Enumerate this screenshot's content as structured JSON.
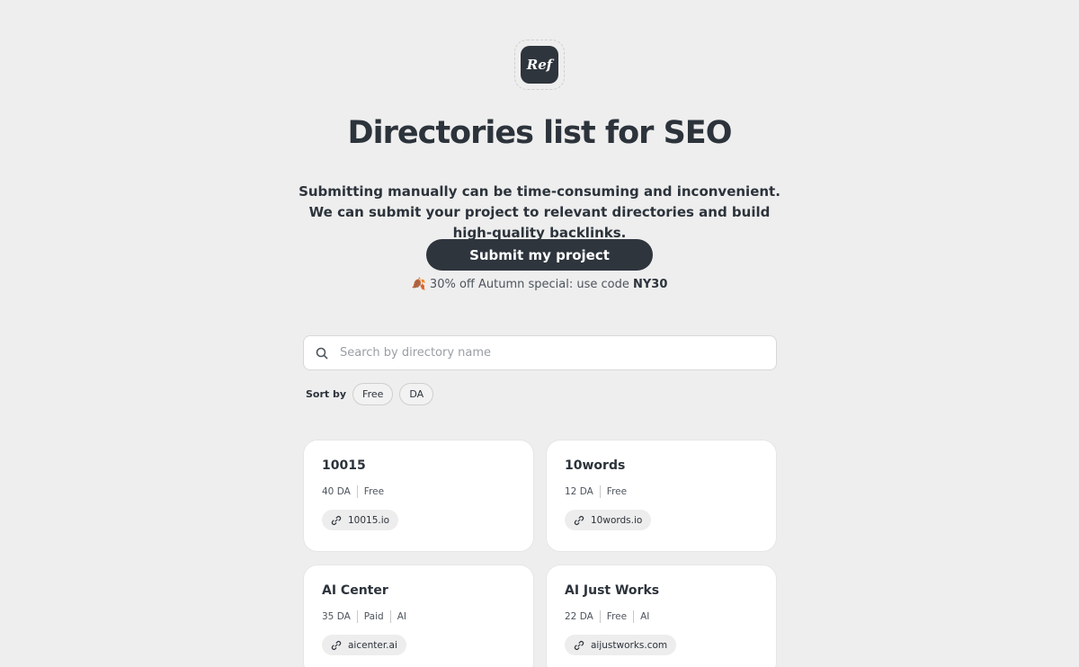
{
  "logo": {
    "text": "Ref"
  },
  "hero": {
    "title": "Directories list for SEO",
    "subtitle": "Submitting manually can be time-consuming and inconvenient. We can submit your project to relevant directories and build high-quality backlinks.",
    "cta_label": "Submit my project",
    "promo_icon": "🍂",
    "promo_text": "30% off Autumn special: use code",
    "promo_code": "NY30"
  },
  "search": {
    "placeholder": "Search by directory name",
    "value": ""
  },
  "sort": {
    "label": "Sort by",
    "options": [
      "Free",
      "DA"
    ]
  },
  "directories": [
    {
      "name": "10015",
      "da": "40 DA",
      "pricing": "Free",
      "category": "",
      "url": "10015.io"
    },
    {
      "name": "10words",
      "da": "12 DA",
      "pricing": "Free",
      "category": "",
      "url": "10words.io"
    },
    {
      "name": "AI Center",
      "da": "35 DA",
      "pricing": "Paid",
      "category": "AI",
      "url": "aicenter.ai"
    },
    {
      "name": "AI Just Works",
      "da": "22 DA",
      "pricing": "Free",
      "category": "AI",
      "url": "aijustworks.com"
    }
  ]
}
